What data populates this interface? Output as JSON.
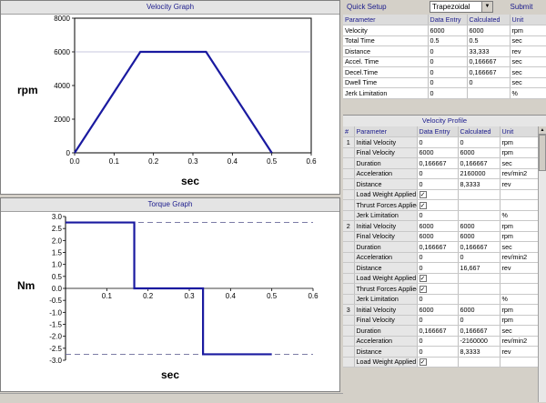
{
  "velocity_graph": {
    "title": "Velocity Graph",
    "ylabel": "rpm",
    "xlabel": "sec",
    "x_ticks": [
      "0.0",
      "0.1",
      "0.2",
      "0.3",
      "0.4",
      "0.5",
      "0.6"
    ],
    "y_ticks": [
      "0",
      "2000",
      "4000",
      "6000",
      "8000"
    ],
    "line_color": "#1a1aa0"
  },
  "torque_graph": {
    "title": "Torque Graph",
    "ylabel": "Nm",
    "xlabel": "sec",
    "x_ticks": [
      "0.1",
      "0.2",
      "0.3",
      "0.4",
      "0.5",
      "0.6"
    ],
    "y_ticks": [
      "3.0",
      "2.5",
      "2.0",
      "1.5",
      "1.0",
      "0.5",
      "0.0",
      "-0.5",
      "-1.0",
      "-1.5",
      "-2.0",
      "-2.5",
      "-3.0"
    ],
    "line_color": "#1a1aa0"
  },
  "chart_data": [
    {
      "type": "line",
      "title": "Velocity Graph",
      "xlabel": "sec",
      "ylabel": "rpm",
      "xlim": [
        0,
        0.6
      ],
      "ylim": [
        0,
        8000
      ],
      "series": [
        {
          "x": [
            0,
            0.166667,
            0.333333,
            0.5
          ],
          "y": [
            0,
            6000,
            6000,
            0
          ]
        }
      ],
      "grid": false
    },
    {
      "type": "line",
      "title": "Torque Graph",
      "xlabel": "sec",
      "ylabel": "Nm",
      "xlim": [
        0,
        0.6
      ],
      "ylim": [
        -3,
        3
      ],
      "series": [
        {
          "x": [
            0,
            0.166667,
            0.166667,
            0.333333,
            0.333333,
            0.5
          ],
          "y": [
            2.75,
            2.75,
            0,
            0,
            -2.75,
            -2.75
          ]
        }
      ],
      "limit_lines": [
        2.75,
        -2.75
      ],
      "grid": false
    }
  ],
  "quick_setup": {
    "label": "Quick Setup",
    "mode_value": "Trapezoidal",
    "submit_label": "Submit",
    "headers": [
      "Parameter",
      "Data Entry",
      "Calculated",
      "Unit"
    ],
    "rows": [
      [
        "Velocity",
        "6000",
        "6000",
        "rpm"
      ],
      [
        "Total Time",
        "0.5",
        "0.5",
        "sec"
      ],
      [
        "Distance",
        "0",
        "33,333",
        "rev"
      ],
      [
        "Accel. Time",
        "0",
        "0,166667",
        "sec"
      ],
      [
        "Decel.Time",
        "0",
        "0,166667",
        "sec"
      ],
      [
        "Dwell Time",
        "0",
        "0",
        "sec"
      ],
      [
        "Jerk Limitation",
        "0",
        "",
        "%"
      ]
    ]
  },
  "velocity_profile": {
    "title": "Velocity Profile",
    "headers": [
      "#",
      "Parameter",
      "Data Entry",
      "Calculated",
      "Unit"
    ],
    "rows": [
      [
        "1",
        "Initial Velocity",
        "0",
        "0",
        "rpm"
      ],
      [
        "",
        "Final Velocity",
        "6000",
        "6000",
        "rpm"
      ],
      [
        "",
        "Duration",
        "0,166667",
        "0,166667",
        "sec"
      ],
      [
        "",
        "Acceleration",
        "0",
        "2160000",
        "rev/min2"
      ],
      [
        "",
        "Distance",
        "0",
        "8,3333",
        "rev"
      ],
      [
        "",
        "Load Weight Applied",
        "check",
        "",
        ""
      ],
      [
        "",
        "Thrust Forces Applied",
        "check",
        "",
        ""
      ],
      [
        "",
        "Jerk Limitation",
        "0",
        "",
        "%"
      ],
      [
        "2",
        "Initial Velocity",
        "6000",
        "6000",
        "rpm"
      ],
      [
        "",
        "Final Velocity",
        "6000",
        "6000",
        "rpm"
      ],
      [
        "",
        "Duration",
        "0,166667",
        "0,166667",
        "sec"
      ],
      [
        "",
        "Acceleration",
        "0",
        "0",
        "rev/min2"
      ],
      [
        "",
        "Distance",
        "0",
        "16,667",
        "rev"
      ],
      [
        "",
        "Load Weight Applied",
        "check",
        "",
        ""
      ],
      [
        "",
        "Thrust Forces Applied",
        "check",
        "",
        ""
      ],
      [
        "",
        "Jerk Limitation",
        "0",
        "",
        "%"
      ],
      [
        "3",
        "Initial Velocity",
        "6000",
        "6000",
        "rpm"
      ],
      [
        "",
        "Final Velocity",
        "0",
        "0",
        "rpm"
      ],
      [
        "",
        "Duration",
        "0,166667",
        "0,166667",
        "sec"
      ],
      [
        "",
        "Acceleration",
        "0",
        "-2160000",
        "rev/min2"
      ],
      [
        "",
        "Distance",
        "0",
        "8,3333",
        "rev"
      ],
      [
        "",
        "Load Weight Applied",
        "check",
        "",
        ""
      ]
    ]
  }
}
